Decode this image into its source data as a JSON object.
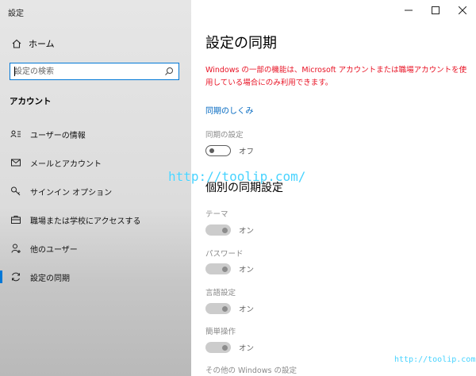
{
  "window": {
    "title": "設定"
  },
  "sidebar": {
    "home_label": "ホーム",
    "search": {
      "placeholder": "設定の検索"
    },
    "section_header": "アカウント",
    "items": [
      {
        "label": "ユーザーの情報",
        "icon": "user-info-icon"
      },
      {
        "label": "メールとアカウント",
        "icon": "mail-icon"
      },
      {
        "label": "サインイン オプション",
        "icon": "key-icon"
      },
      {
        "label": "職場または学校にアクセスする",
        "icon": "briefcase-icon"
      },
      {
        "label": "他のユーザー",
        "icon": "person-icon"
      },
      {
        "label": "設定の同期",
        "icon": "sync-icon",
        "active": true
      }
    ]
  },
  "main": {
    "title": "設定の同期",
    "warning": "Windows の一部の機能は、Microsoft アカウントまたは職場アカウントを使用している場合にのみ利用できます。",
    "link": "同期のしくみ",
    "sync_setting": {
      "label": "同期の設定",
      "state": "オフ"
    },
    "individual_heading": "個別の同期設定",
    "individual": [
      {
        "label": "テーマ",
        "state": "オン"
      },
      {
        "label": "パスワード",
        "state": "オン"
      },
      {
        "label": "言語設定",
        "state": "オン"
      },
      {
        "label": "簡単操作",
        "state": "オン"
      }
    ],
    "other_label": "その他の Windows の設定"
  },
  "watermarks": [
    "http://toolip.com/",
    "http://toolip.com/"
  ],
  "colors": {
    "accent": "#0078d7",
    "warning": "#e81123",
    "link": "#0067c0"
  }
}
